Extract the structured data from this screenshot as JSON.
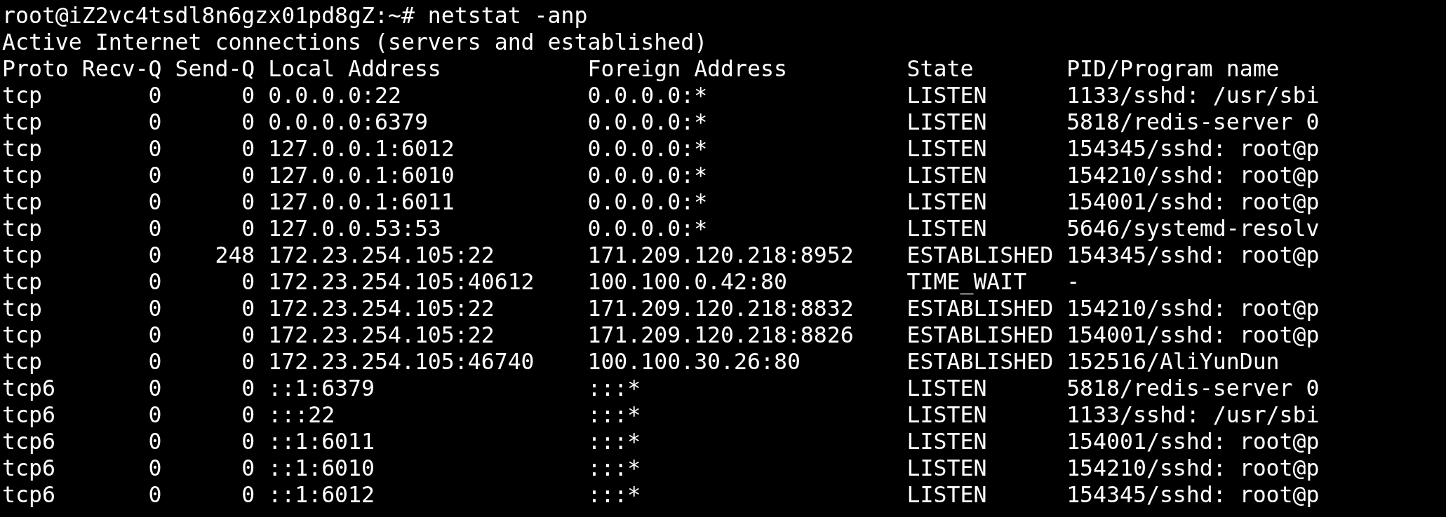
{
  "prompt": {
    "text": "root@iZ2vc4tsdl8n6gzx01pd8gZ:~# netstat -anp"
  },
  "title_line": "Active Internet connections (servers and established)",
  "table": {
    "columns": [
      "Proto",
      "Recv-Q",
      "Send-Q",
      "Local Address",
      "Foreign Address",
      "State",
      "PID/Program name"
    ],
    "rows": [
      [
        "tcp",
        "0",
        "0",
        "0.0.0.0:22",
        "0.0.0.0:*",
        "LISTEN",
        "1133/sshd: /usr/sbi"
      ],
      [
        "tcp",
        "0",
        "0",
        "0.0.0.0:6379",
        "0.0.0.0:*",
        "LISTEN",
        "5818/redis-server 0"
      ],
      [
        "tcp",
        "0",
        "0",
        "127.0.0.1:6012",
        "0.0.0.0:*",
        "LISTEN",
        "154345/sshd: root@p"
      ],
      [
        "tcp",
        "0",
        "0",
        "127.0.0.1:6010",
        "0.0.0.0:*",
        "LISTEN",
        "154210/sshd: root@p"
      ],
      [
        "tcp",
        "0",
        "0",
        "127.0.0.1:6011",
        "0.0.0.0:*",
        "LISTEN",
        "154001/sshd: root@p"
      ],
      [
        "tcp",
        "0",
        "0",
        "127.0.0.53:53",
        "0.0.0.0:*",
        "LISTEN",
        "5646/systemd-resolv"
      ],
      [
        "tcp",
        "0",
        "248",
        "172.23.254.105:22",
        "171.209.120.218:8952",
        "ESTABLISHED",
        "154345/sshd: root@p"
      ],
      [
        "tcp",
        "0",
        "0",
        "172.23.254.105:40612",
        "100.100.0.42:80",
        "TIME_WAIT",
        "-"
      ],
      [
        "tcp",
        "0",
        "0",
        "172.23.254.105:22",
        "171.209.120.218:8832",
        "ESTABLISHED",
        "154210/sshd: root@p"
      ],
      [
        "tcp",
        "0",
        "0",
        "172.23.254.105:22",
        "171.209.120.218:8826",
        "ESTABLISHED",
        "154001/sshd: root@p"
      ],
      [
        "tcp",
        "0",
        "0",
        "172.23.254.105:46740",
        "100.100.30.26:80",
        "ESTABLISHED",
        "152516/AliYunDun"
      ],
      [
        "tcp6",
        "0",
        "0",
        "::1:6379",
        ":::*",
        "LISTEN",
        "5818/redis-server 0"
      ],
      [
        "tcp6",
        "0",
        "0",
        ":::22",
        ":::*",
        "LISTEN",
        "1133/sshd: /usr/sbi"
      ],
      [
        "tcp6",
        "0",
        "0",
        "::1:6011",
        ":::*",
        "LISTEN",
        "154001/sshd: root@p"
      ],
      [
        "tcp6",
        "0",
        "0",
        "::1:6010",
        ":::*",
        "LISTEN",
        "154210/sshd: root@p"
      ],
      [
        "tcp6",
        "0",
        "0",
        "::1:6012",
        ":::*",
        "LISTEN",
        "154345/sshd: root@p"
      ]
    ]
  }
}
